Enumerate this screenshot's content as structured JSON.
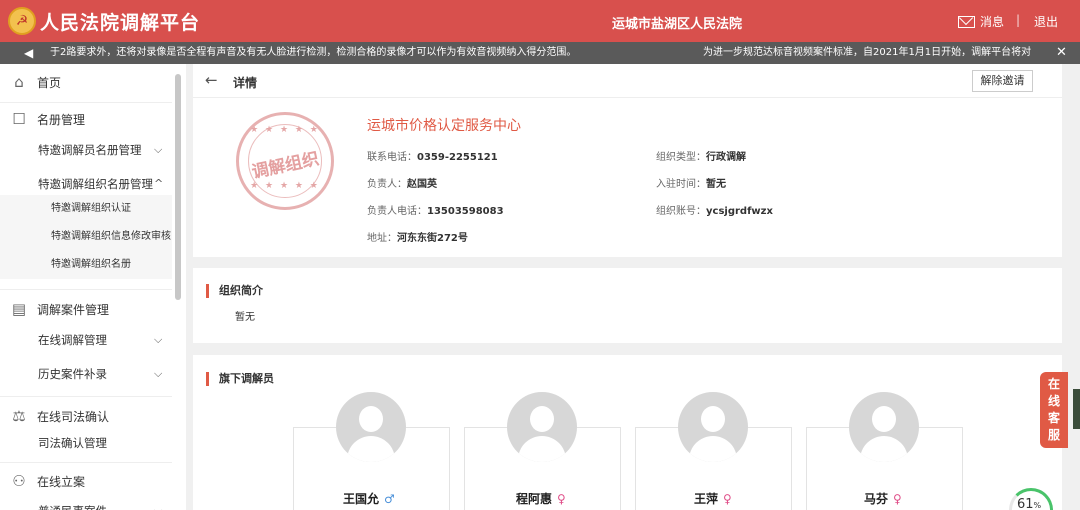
{
  "header": {
    "logo_glyph": "☭",
    "app_title": "人民法院调解平台",
    "court_name": "运城市盐湖区人民法院",
    "messages_label": "消息",
    "separator": "|",
    "logout_label": "退出"
  },
  "notice": {
    "text_left": "于2路要求外，还将对录像是否全程有声音及有无人脸进行检测，检测合格的录像才可以作为有效音视频纳入得分范围。",
    "text_right": "为进一步规范达标音视频案件标准，自2021年1月1日开始，调解平台将对",
    "close_glyph": "✕"
  },
  "sidebar": {
    "home": "首页",
    "roster": "名册管理",
    "invited_mediator_roster": "特邀调解员名册管理",
    "invited_org_roster": "特邀调解组织名册管理",
    "org_certification": "特邀调解组织认证",
    "org_info_review": "特邀调解组织信息修改审核",
    "org_roster": "特邀调解组织名册",
    "case_mgmt": "调解案件管理",
    "online_mediation_mgmt": "在线调解管理",
    "history_case_supplement": "历史案件补录",
    "judicial_confirm": "在线司法确认",
    "judicial_confirm_mgmt": "司法确认管理",
    "online_filing": "在线立案",
    "general_cases": "普通民事案件"
  },
  "breadcrumb": {
    "back_glyph": "←",
    "title": "详情",
    "release_button": "解除邀请"
  },
  "org": {
    "stamp_text": "调解组织",
    "stamp_stars": "★ ★ ★ ★ ★",
    "name": "运城市价格认定服务中心",
    "phone_label": "联系电话：",
    "phone": "0359-2255121",
    "leader_label": "负责人：",
    "leader": "赵国英",
    "leader_phone_label": "负责人电话：",
    "leader_phone": "13503598083",
    "address_label": "地址：",
    "address": "河东东街272号",
    "type_label": "组织类型：",
    "type": "行政调解",
    "join_label": "入驻时间：",
    "join_time": "暂无",
    "account_label": "组织账号：",
    "account": "ycsjgrdfwzx"
  },
  "intro": {
    "title": "组织简介",
    "content": "暂无"
  },
  "staff": {
    "title": "旗下调解员",
    "members": [
      {
        "name": "王国允",
        "gender_glyph": "♂",
        "gender": "male"
      },
      {
        "name": "程阿惠",
        "gender_glyph": "♀",
        "gender": "female"
      },
      {
        "name": "王萍",
        "gender_glyph": "♀",
        "gender": "female"
      },
      {
        "name": "马芬",
        "gender_glyph": "♀",
        "gender": "female"
      }
    ]
  },
  "service": {
    "label_1": "在",
    "label_2": "线",
    "label_3": "客",
    "label_4": "服"
  },
  "progress": {
    "value": "61",
    "unit": "%"
  },
  "colors": {
    "header_red": "#d8504d",
    "accent_red": "#e05a45",
    "notice_gray": "#5a5a5a",
    "male_blue": "#4a90d9",
    "female_pink": "#e0508a",
    "progress_green": "#49c36a"
  }
}
